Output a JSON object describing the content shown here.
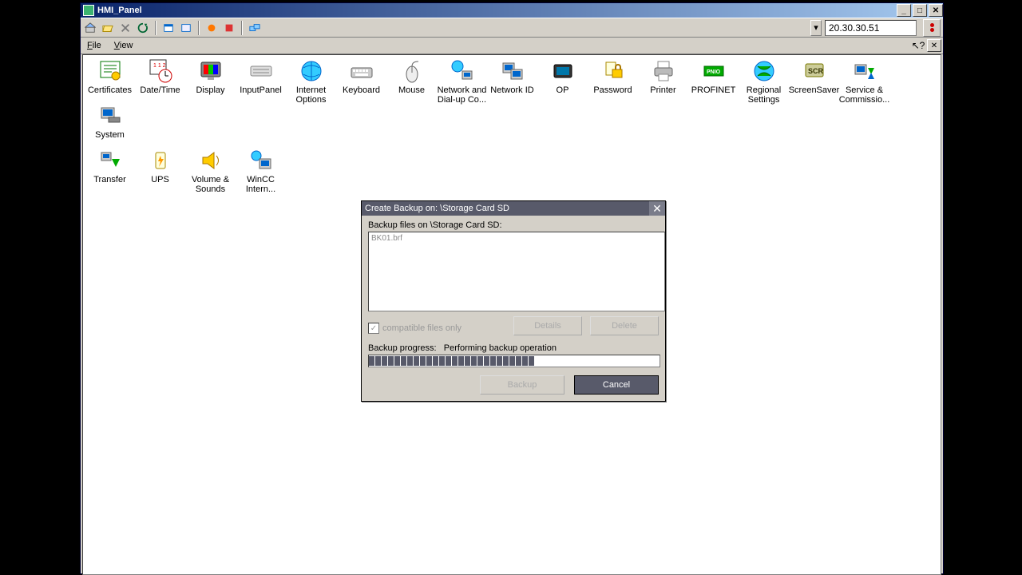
{
  "window": {
    "title": "HMI_Panel"
  },
  "toolbar": {
    "ip": "20.30.30.51"
  },
  "menu": {
    "file": "File",
    "view": "View"
  },
  "icons": [
    {
      "id": "certificates",
      "label": "Certificates"
    },
    {
      "id": "datetime",
      "label": "Date/Time"
    },
    {
      "id": "display",
      "label": "Display"
    },
    {
      "id": "inputpanel",
      "label": "InputPanel"
    },
    {
      "id": "internet",
      "label": "Internet Options"
    },
    {
      "id": "keyboard",
      "label": "Keyboard"
    },
    {
      "id": "mouse",
      "label": "Mouse"
    },
    {
      "id": "network-conn",
      "label": "Network and Dial-up Co..."
    },
    {
      "id": "network-id",
      "label": "Network ID"
    },
    {
      "id": "op",
      "label": "OP"
    },
    {
      "id": "password",
      "label": "Password"
    },
    {
      "id": "printer",
      "label": "Printer"
    },
    {
      "id": "profinet",
      "label": "PROFINET"
    },
    {
      "id": "regional",
      "label": "Regional Settings"
    },
    {
      "id": "screensaver",
      "label": "ScreenSaver"
    },
    {
      "id": "service",
      "label": "Service & Commissio..."
    },
    {
      "id": "system",
      "label": "System"
    },
    {
      "id": "transfer",
      "label": "Transfer"
    },
    {
      "id": "ups",
      "label": "UPS"
    },
    {
      "id": "volume",
      "label": "Volume & Sounds"
    },
    {
      "id": "wincc",
      "label": "WinCC Intern..."
    }
  ],
  "dialog": {
    "title": "Create Backup on: \\Storage Card SD",
    "list_label": "Backup files on \\Storage Card SD:",
    "file_entry": "BK01.brf",
    "compatible_label": "compatible files only",
    "details_btn": "Details",
    "delete_btn": "Delete",
    "progress_label": "Backup progress:",
    "progress_status": "Performing backup operation",
    "backup_btn": "Backup",
    "cancel_btn": "Cancel"
  }
}
